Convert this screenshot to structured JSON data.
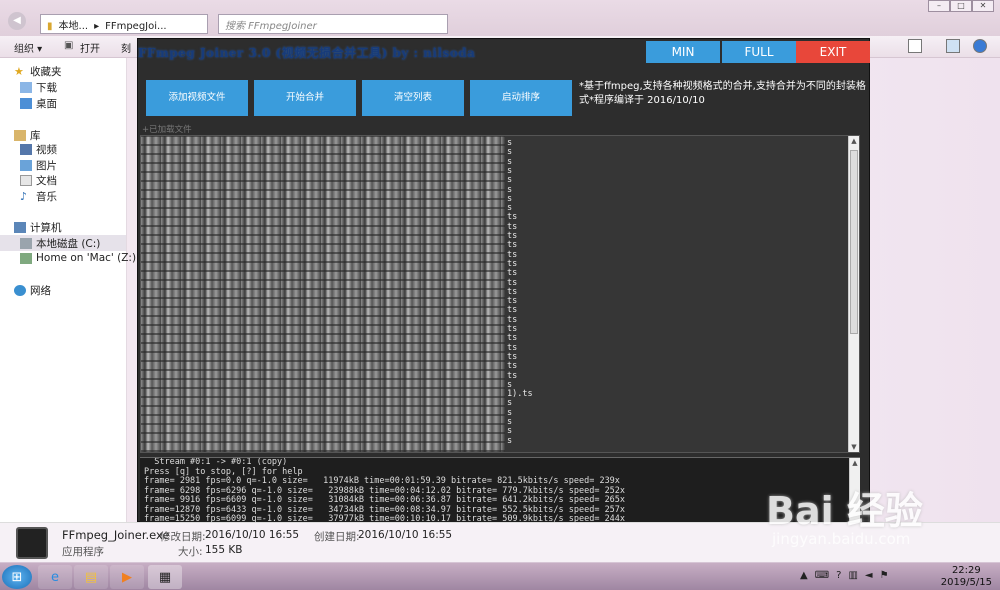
{
  "explorer": {
    "address_parts": [
      "本地...",
      "FFmpegJoi..."
    ],
    "search_placeholder": "搜索 FFmpegJoiner",
    "toolbar": {
      "organize": "组织 ▾",
      "open": "打开",
      "more": "刻"
    },
    "sidebar": {
      "favorites": "收藏夹",
      "downloads": "下载",
      "desktop": "桌面",
      "library": "库",
      "videos": "视频",
      "pictures": "图片",
      "documents": "文档",
      "music": "音乐",
      "computer": "计算机",
      "local_disk": "本地磁盘 (C:)",
      "home_mac": "Home on 'Mac' (Z:)",
      "network": "网络"
    },
    "details": {
      "filename": "FFmpeg_Joiner.exe",
      "filetype": "应用程序",
      "modified_label": "修改日期:",
      "modified": "2016/10/10 16:55",
      "created_label": "创建日期:",
      "created": "2016/10/10 16:55",
      "size_label": "大小:",
      "size": "155 KB"
    }
  },
  "app": {
    "title": "FFmpeg Joiner 3.0 (视频无损合并工具) by : nilsoda",
    "buttons": {
      "min": "MIN",
      "full": "FULL",
      "exit": "EXIT"
    },
    "actions": [
      "添加视频文件",
      "开始合并",
      "清空列表",
      "启动排序"
    ],
    "note": "*基于ffmpeg,支持各种视频格式的合并,支持合并为不同的封装格式*程序编译于 2016/10/10",
    "loaded_label": "+已加载文件",
    "list_suffixes": [
      "s",
      "s",
      "s",
      "s",
      "s",
      "s",
      "s",
      "s",
      "ts",
      "ts",
      "ts",
      "ts",
      "ts",
      "ts",
      "ts",
      "ts",
      "ts",
      "ts",
      "ts",
      "ts",
      "ts",
      "ts",
      "ts",
      "ts",
      "ts",
      "ts",
      "s",
      "1).ts",
      "s",
      "s",
      "s",
      "s",
      "s"
    ],
    "log": [
      "  Stream #0:1 -> #0:1 (copy)",
      "Press [q] to stop, [?] for help",
      "frame= 2981 fps=0.0 q=-1.0 size=   11974kB time=00:01:59.39 bitrate= 821.5kbits/s speed= 239x",
      "frame= 6298 fps=6296 q=-1.0 size=   23988kB time=00:04:12.02 bitrate= 779.7kbits/s speed= 252x",
      "frame= 9916 fps=6609 q=-1.0 size=   31084kB time=00:06:36.87 bitrate= 641.2kbits/s speed= 265x",
      "frame=12870 fps=6433 q=-1.0 size=   34734kB time=00:08:34.97 bitrate= 552.5kbits/s speed= 257x",
      "frame=15250 fps=6099 q=-1.0 size=   37977kB time=00:10:10.17 bitrate= 509.9kbits/s speed= 244x"
    ]
  },
  "taskbar": {
    "time": "22:29",
    "date": "2019/5/15"
  },
  "watermark": {
    "logo": "Bai 经验",
    "url": "jingyan.baidu.com"
  },
  "colors": {
    "accent_blue": "#3a9cdc",
    "exit_red": "#e8473a",
    "app_bg": "#2d2d2d"
  }
}
